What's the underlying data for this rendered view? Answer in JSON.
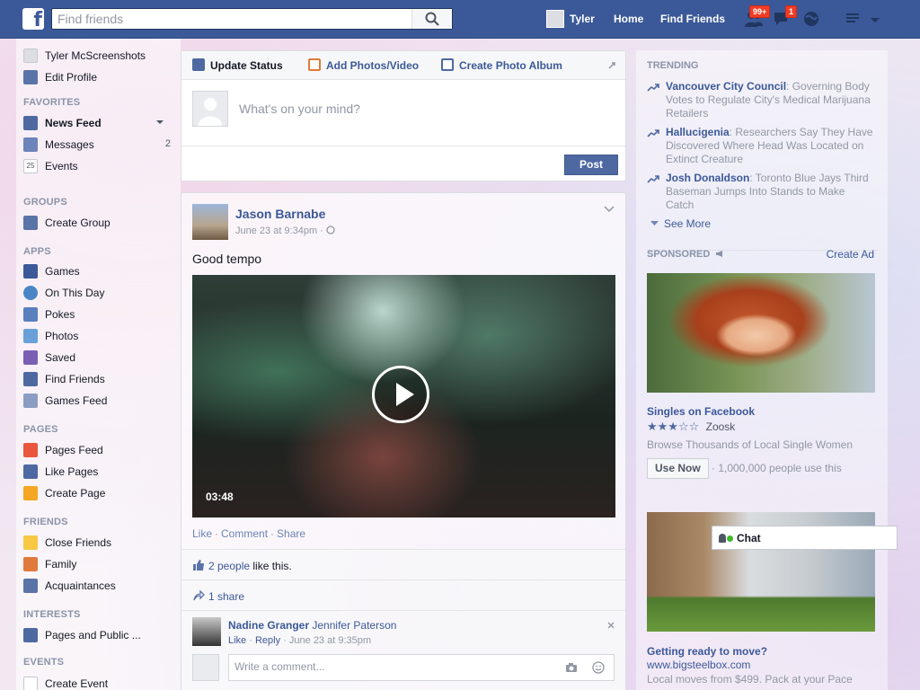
{
  "topbar": {
    "logo": "f",
    "search_placeholder": "Find friends",
    "user_name": "Tyler",
    "home": "Home",
    "find_friends": "Find Friends",
    "friend_requests_badge": "99+",
    "messages_badge": "1"
  },
  "sidebar": {
    "profile_name": "Tyler McScreenshots",
    "edit_profile": "Edit Profile",
    "favorites_header": "FAVORITES",
    "news_feed": "News Feed",
    "messages": "Messages",
    "messages_count": "2",
    "events": "Events",
    "events_icon_day": "25",
    "groups_header": "GROUPS",
    "create_group": "Create Group",
    "apps_header": "APPS",
    "games": "Games",
    "on_this_day": "On This Day",
    "pokes": "Pokes",
    "photos": "Photos",
    "saved": "Saved",
    "find_friends": "Find Friends",
    "games_feed": "Games Feed",
    "pages_header": "PAGES",
    "pages_feed": "Pages Feed",
    "like_pages": "Like Pages",
    "create_page": "Create Page",
    "friends_header": "FRIENDS",
    "close_friends": "Close Friends",
    "family": "Family",
    "acquaintances": "Acquaintances",
    "interests_header": "INTERESTS",
    "pages_and_public": "Pages and Public ...",
    "events_header": "EVENTS",
    "create_event": "Create Event"
  },
  "composer": {
    "tab_update_status": "Update Status",
    "tab_add_photos": "Add Photos/Video",
    "tab_create_album": "Create Photo Album",
    "placeholder": "What's on your mind?",
    "post": "Post"
  },
  "story": {
    "author": "Jason Barnabe",
    "timestamp": "June 23 at 9:34pm · ",
    "text": "Good tempo",
    "video_duration": "03:48",
    "action_like": "Like",
    "action_comment": "Comment",
    "action_share": "Share",
    "likes_link": "2 people",
    "likes_suffix": " like this.",
    "shares": "1 share",
    "comment_author": "Nadine Granger",
    "comment_text": "Jennifer Paterson",
    "comment_like": "Like",
    "comment_reply": "Reply",
    "comment_time": "June 23 at 9:35pm",
    "comment_placeholder": "Write a comment..."
  },
  "trending": {
    "header": "TRENDING",
    "items": [
      {
        "topic": "Vancouver City Council",
        "desc": ": Governing Body Votes to Regulate City's Medical Marijuana Retailers"
      },
      {
        "topic": "Hallucigenia",
        "desc": ": Researchers Say They Have Discovered Where Head Was Located on Extinct Creature"
      },
      {
        "topic": "Josh Donaldson",
        "desc": ": Toronto Blue Jays Third Baseman Jumps Into Stands to Make Catch"
      }
    ],
    "see_more": "See More"
  },
  "sponsored": {
    "header": "SPONSORED",
    "create_ad": "Create Ad",
    "ad1_title": "Singles on Facebook",
    "ad1_stars": "★★★☆☆",
    "ad1_rating": 2.5,
    "ad1_app": "Zoosk",
    "ad1_desc": "Browse Thousands of Local Single Women",
    "ad1_button": "Use Now",
    "ad1_social": "· 1,000,000 people use this",
    "ad2_title": "Getting ready to move?",
    "ad2_url": "www.bigsteelbox.com",
    "ad2_desc": "Local moves from $499. Pack at your Pace"
  },
  "chat": {
    "label": "Chat"
  },
  "colors": {
    "brand_blue": "#3b5998",
    "link_blue": "#3b5998",
    "badge_red": "#f03d25",
    "online_green": "#42b72a"
  }
}
